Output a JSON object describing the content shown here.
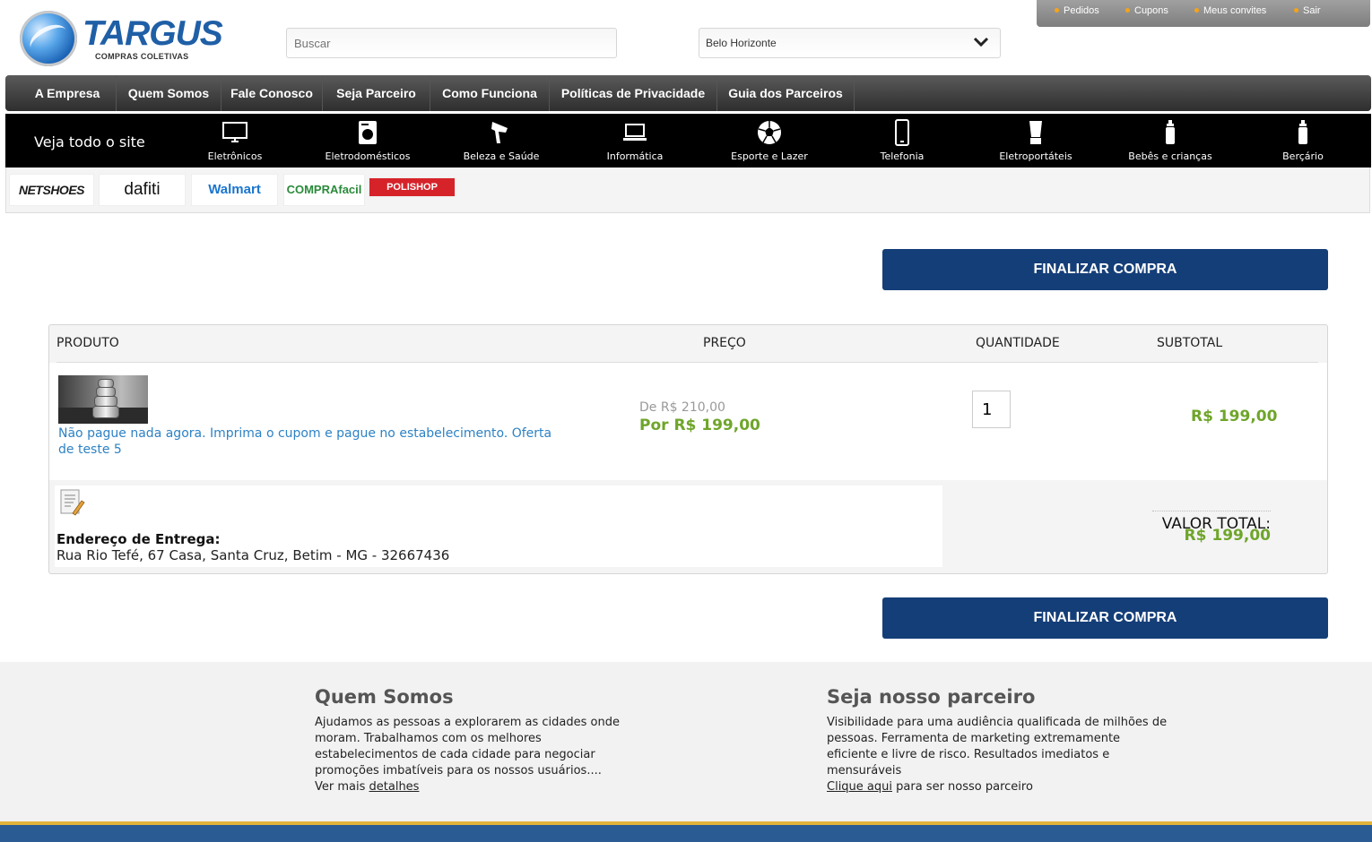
{
  "header": {
    "logo": {
      "brand": "TARGUS",
      "subtitle": "COMPRAS COLETIVAS"
    },
    "search_placeholder": "Buscar",
    "city": "Belo Horizonte",
    "user_menu": [
      "Pedidos",
      "Cupons",
      "Meus convites",
      "Sair"
    ]
  },
  "nav": [
    "A Empresa",
    "Quem Somos",
    "Fale Conosco",
    "Seja Parceiro",
    "Como Funciona",
    "Políticas de Privacidade",
    "Guia dos Parceiros"
  ],
  "categories": {
    "lead": "Veja todo o site",
    "items": [
      {
        "label": "Eletrônicos",
        "icon": "monitor-icon"
      },
      {
        "label": "Eletrodomésticos",
        "icon": "washing-machine-icon"
      },
      {
        "label": "Beleza e Saúde",
        "icon": "hair-dryer-icon"
      },
      {
        "label": "Informática",
        "icon": "laptop-icon"
      },
      {
        "label": "Esporte e Lazer",
        "icon": "soccer-ball-icon"
      },
      {
        "label": "Telefonia",
        "icon": "phone-icon"
      },
      {
        "label": "Eletroportáteis",
        "icon": "blender-icon"
      },
      {
        "label": "Bebês e crianças",
        "icon": "baby-bottle-icon"
      },
      {
        "label": "Berçário",
        "icon": "baby-bottle-icon"
      }
    ]
  },
  "partners": [
    {
      "name": "NETSHOES",
      "color": "#1a1a1a"
    },
    {
      "name": "dafiti",
      "color": "#111111"
    },
    {
      "name": "Walmart",
      "color": "#1a75cf"
    },
    {
      "name": "COMPRAfacil",
      "color": "#2a8a3a"
    },
    {
      "name": "POLISHOP",
      "color": "#d6232a"
    }
  ],
  "checkout_button": "FINALIZAR COMPRA",
  "cart": {
    "headers": {
      "product": "PRODUTO",
      "price": "PREÇO",
      "quantity": "QUANTIDADE",
      "subtotal": "SUBTOTAL"
    },
    "item": {
      "name": "Não pague nada agora. Imprima o cupom e pague no estabelecimento. Oferta de teste 5",
      "price_from": "De R$ 210,00",
      "price_now": "Por R$ 199,00",
      "quantity": "1",
      "subtotal": "R$ 199,00"
    },
    "delivery": {
      "label": "Endereço de Entrega:",
      "address": "Rua Rio Tefé, 67 Casa, Santa Cruz, Betim - MG - 32667436"
    },
    "total": {
      "label": "VALOR TOTAL:",
      "value": "R$ 199,00"
    }
  },
  "footer": {
    "about": {
      "title": "Quem Somos",
      "text": "Ajudamos as pessoas a explorarem as cidades onde moram. Trabalhamos com os melhores estabelecimentos de cada cidade para negociar promoções imbatíveis para os nossos usuários....",
      "more_prefix": "Ver mais ",
      "more_link": "detalhes"
    },
    "partner": {
      "title": "Seja nosso parceiro",
      "text": "Visibilidade para uma audiência qualificada de milhões de pessoas. Ferramenta de marketing extremamente eficiente e livre de risco. Resultados imediatos e mensuráveis",
      "link": "Clique aqui",
      "link_suffix": " para ser nosso parceiro"
    }
  },
  "colors": {
    "accent_blue": "#143e78",
    "price_green": "#6fa52a",
    "link_blue": "#2d82c4"
  }
}
